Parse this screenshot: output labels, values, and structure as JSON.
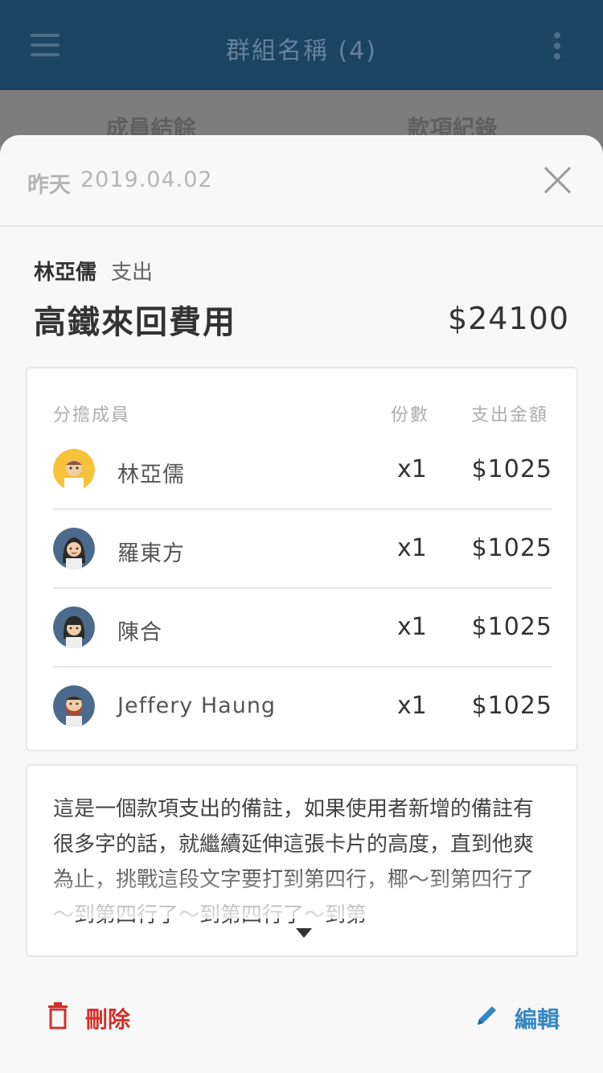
{
  "appbar": {
    "title": "群組名稱 (4)"
  },
  "tabs": [
    {
      "label": "成員結餘"
    },
    {
      "label": "款項紀錄"
    }
  ],
  "sheet": {
    "date_label": "昨天",
    "date_value": "2019.04.02",
    "payer_name": "林亞儒",
    "payer_action": "支出",
    "item_title": "高鐵來回費用",
    "item_amount": "$24100"
  },
  "split": {
    "headers": {
      "member": "分擔成員",
      "shares": "份數",
      "amount": "支出金額"
    },
    "rows": [
      {
        "name": "林亞儒",
        "shares": "x1",
        "amount": "$1025",
        "avatar": "avatar-yellow-man"
      },
      {
        "name": "羅東方",
        "shares": "x1",
        "amount": "$1025",
        "avatar": "avatar-woman-long-hair"
      },
      {
        "name": "陳合",
        "shares": "x1",
        "amount": "$1025",
        "avatar": "avatar-woman-bangs"
      },
      {
        "name": "Jeffery Haung",
        "shares": "x1",
        "amount": "$1025",
        "avatar": "avatar-bearded-man"
      }
    ]
  },
  "note": {
    "text": "這是一個款項支出的備註，如果使用者新增的備註有很多字的話，就繼續延伸這張卡片的高度，直到他爽為止，挑戰這段文字要打到第四行，椰～到第四行了～到第四行了～到第四行了～到第"
  },
  "actions": {
    "delete_label": "刪除",
    "edit_label": "編輯"
  },
  "colors": {
    "appbar": "#1b4462",
    "delete": "#d0312d",
    "edit": "#3487c3"
  }
}
